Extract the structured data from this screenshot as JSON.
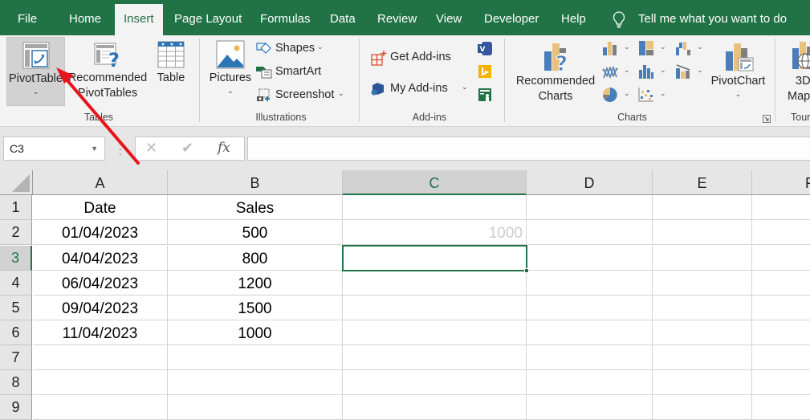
{
  "tabs": [
    {
      "label": "File",
      "active": false
    },
    {
      "label": "Home",
      "active": false
    },
    {
      "label": "Insert",
      "active": true
    },
    {
      "label": "Page Layout",
      "active": false
    },
    {
      "label": "Formulas",
      "active": false
    },
    {
      "label": "Data",
      "active": false
    },
    {
      "label": "Review",
      "active": false
    },
    {
      "label": "View",
      "active": false
    },
    {
      "label": "Developer",
      "active": false
    },
    {
      "label": "Help",
      "active": false
    }
  ],
  "tell_me": "Tell me what you want to do",
  "ribbon": {
    "tables": {
      "label": "Tables",
      "pivottable": "PivotTable",
      "recommended_pivot_1": "Recommended",
      "recommended_pivot_2": "PivotTables",
      "table": "Table"
    },
    "illustrations": {
      "label": "Illustrations",
      "pictures": "Pictures",
      "shapes": "Shapes",
      "smartart": "SmartArt",
      "screenshot": "Screenshot"
    },
    "addins": {
      "label": "Add-ins",
      "get_addins": "Get Add-ins",
      "my_addins": "My Add-ins"
    },
    "charts": {
      "label": "Charts",
      "recommended_1": "Recommended",
      "recommended_2": "Charts",
      "pivotchart": "PivotChart"
    },
    "tours": {
      "label": "Tours",
      "maps_1": "3D",
      "maps_2": "Maps"
    }
  },
  "formula_bar": {
    "name_box": "C3",
    "formula": ""
  },
  "sheet": {
    "columns": [
      "A",
      "B",
      "C",
      "D",
      "E",
      "F"
    ],
    "selected_column": "C",
    "rows": [
      "1",
      "2",
      "3",
      "4",
      "5",
      "6",
      "7",
      "8",
      "9"
    ],
    "selected_row": "3",
    "header": {
      "A": "Date",
      "B": "Sales"
    },
    "data": [
      {
        "date": "01/04/2023",
        "sales": "500"
      },
      {
        "date": "04/04/2023",
        "sales": "800"
      },
      {
        "date": "06/04/2023",
        "sales": "1200"
      },
      {
        "date": "09/04/2023",
        "sales": "1500"
      },
      {
        "date": "11/04/2023",
        "sales": "1000"
      }
    ],
    "ghost_value_C2": "1000",
    "active_cell": "C3"
  },
  "annotation": {
    "type": "arrow",
    "color": "#e8141b",
    "points_to": "PivotTable button"
  },
  "colors": {
    "excel_green": "#217346",
    "ribbon_bg": "#f3f3f3"
  }
}
